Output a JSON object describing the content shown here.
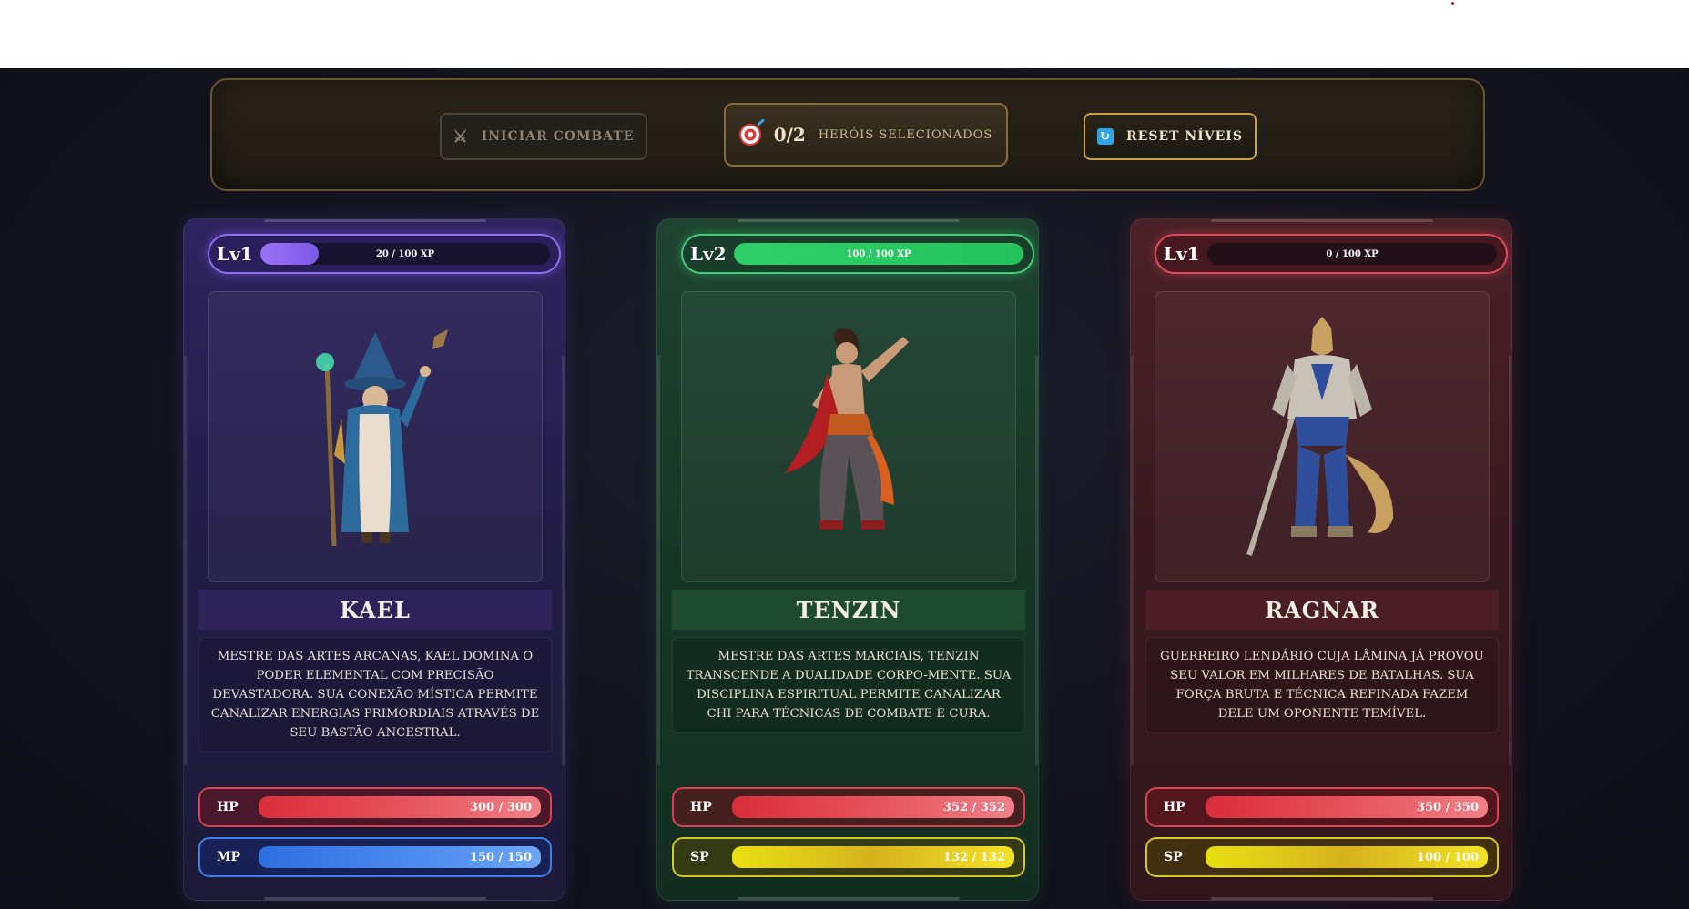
{
  "controls": {
    "start_label": "Iniciar Combate",
    "start_icon": "crossed-swords-icon",
    "selection_count": "0/2",
    "selection_label": "Heróis Selecionados",
    "selection_icon": "target-icon",
    "reset_label": "Reset Níveis",
    "reset_icon": "refresh-icon"
  },
  "heroes": [
    {
      "theme": "purple",
      "level": "Lv1",
      "xp_text": "20 / 100 XP",
      "xp_fraction": 0.2,
      "name": "Kael",
      "portrait": "wizard-portrait",
      "description": "Mestre das artes arcanas, Kael domina o poder elemental com precisão devastadora. Sua conexão mística permite canalizar energias primordiais através de seu bastão ancestral.",
      "hp_label": "HP",
      "hp_text": "300 / 300",
      "hp_fraction": 1.0,
      "res_label": "MP",
      "res_text": "150 / 150",
      "res_fraction": 1.0
    },
    {
      "theme": "green",
      "level": "Lv2",
      "xp_text": "100 / 100 XP",
      "xp_fraction": 1.0,
      "name": "Tenzin",
      "portrait": "monk-portrait",
      "description": "Mestre das artes marciais, Tenzin transcende a dualidade corpo-mente. Sua disciplina espiritual permite canalizar chi para técnicas de combate e cura.",
      "hp_label": "HP",
      "hp_text": "352 / 352",
      "hp_fraction": 1.0,
      "res_label": "SP",
      "res_text": "132 / 132",
      "res_fraction": 1.0
    },
    {
      "theme": "red",
      "level": "Lv1",
      "xp_text": "0 / 100 XP",
      "xp_fraction": 0.0,
      "name": "Ragnar",
      "portrait": "dragon-warrior-portrait",
      "description": "Guerreiro lendário cuja lâmina já provou seu valor em milhares de batalhas. Sua força bruta e técnica refinada fazem dele um oponente temível.",
      "hp_label": "HP",
      "hp_text": "350 / 350",
      "hp_fraction": 1.0,
      "res_label": "SP",
      "res_text": "100 / 100",
      "res_fraction": 1.0
    }
  ]
}
